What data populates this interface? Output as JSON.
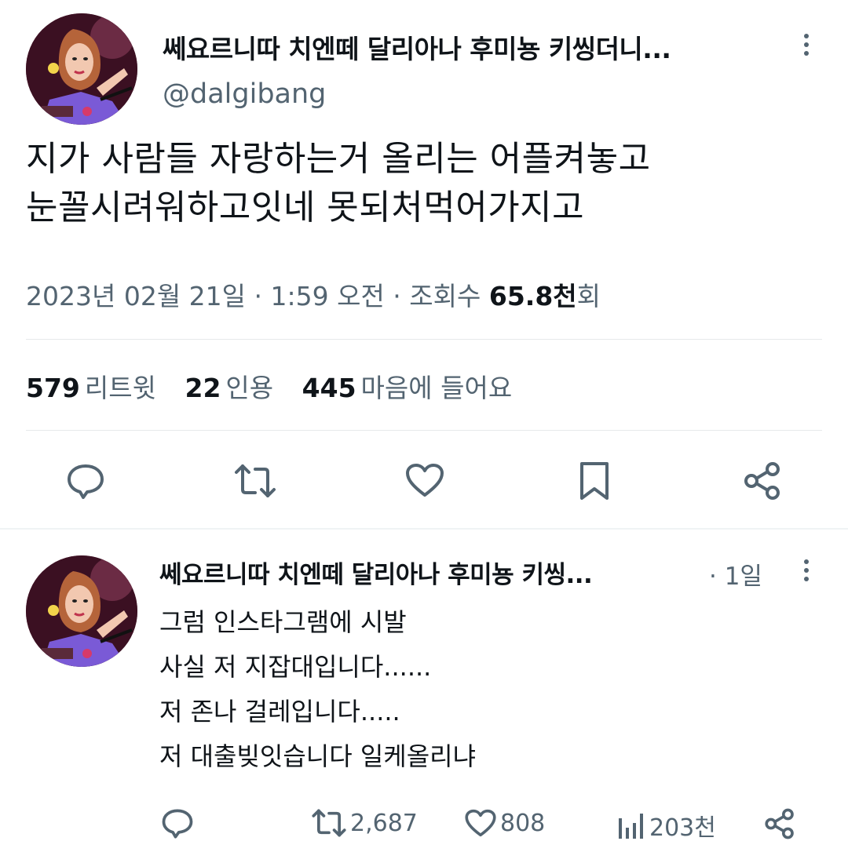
{
  "tweet": {
    "author_name": "쎄요르니따 치엔떼 달리아나 후미뇽 키씽더니...",
    "handle": "@dalgibang",
    "text_lines": [
      "지가 사람들 자랑하는거 올리는 어플켜놓고",
      "눈꼴시려워하고잇네 못되처먹어가지고"
    ],
    "date": "2023년 02월 21일 · 1:59 오전 · 조회수",
    "views_value": "65.8천",
    "views_suffix": "회",
    "stats": {
      "retweets_count": "579",
      "retweets_label": "리트윗",
      "quotes_count": "22",
      "quotes_label": "인용",
      "likes_count": "445",
      "likes_label": "마음에 들어요"
    }
  },
  "reply": {
    "author_name": "쎄요르니따 치엔떼 달리아나 후미뇽 키씽...",
    "time": "· 1일",
    "text_lines": [
      "그럼 인스타그램에 시발",
      "사실 저 지잡대입니다......",
      "저 존나 걸레입니다.....",
      "저 대출빚잇습니다 일케올리냐"
    ],
    "retweets": "2,687",
    "likes": "808",
    "views": "203천"
  },
  "icons": {
    "reply": "comment-icon",
    "retweet": "retweet-icon",
    "like": "heart-icon",
    "bookmark": "bookmark-icon",
    "share": "share-icon",
    "views": "views-icon",
    "more": "more-icon"
  },
  "colors": {
    "text": "#0f1419",
    "secondary": "#536471",
    "divider": "#e6e9eb"
  }
}
